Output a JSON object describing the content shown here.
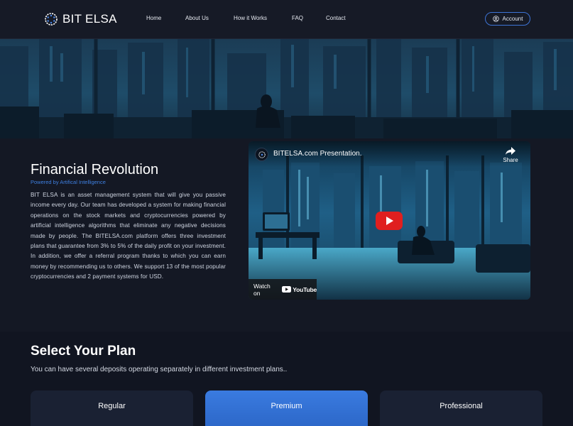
{
  "header": {
    "logo_text": "BIT ELSA",
    "nav": [
      {
        "label": "Home"
      },
      {
        "label": "About Us"
      },
      {
        "label": "How it Works"
      },
      {
        "label": "FAQ"
      },
      {
        "label": "Contact"
      }
    ],
    "account_label": "Account"
  },
  "intro": {
    "title": "Financial Revolution",
    "subtitle": "Powered by Artifical Intelligence",
    "body": "BIT ELSA is an asset management system that will give you passive income every day. Our team has developed a system for making financial operations on the stock markets and cryptocurrencies powered by artificial intelligence algorithms that eliminate any negative decisions made by people. The BITELSA.com platform offers three investment plans that guarantee from 3% to 5% of the daily profit on your investment. In addition, we offer a referral program thanks to which you can earn money by recommending us to others. We support 13 of the most popular cryptocurrencies and 2 payment systems for USD."
  },
  "video": {
    "title": "BITELSA.com Presentation.",
    "share_label": "Share",
    "watch_on_label": "Watch on",
    "youtube_label": "YouTube"
  },
  "plans": {
    "title": "Select Your Plan",
    "subtitle": "You can have several deposits operating separately in different investment plans..",
    "cards": [
      {
        "name": "Regular"
      },
      {
        "name": "Premium"
      },
      {
        "name": "Professional"
      }
    ]
  },
  "colors": {
    "background": "#141824",
    "accent": "#3e7fe0",
    "youtube_red": "#e01f1f"
  }
}
